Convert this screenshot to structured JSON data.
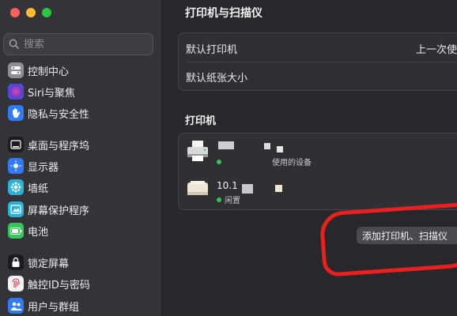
{
  "window": {
    "traffic_lights": {
      "close": "#ff5f57",
      "minimize": "#febc2e",
      "zoom": "#28c840"
    }
  },
  "sidebar": {
    "search_placeholder": "搜索",
    "items": [
      {
        "label": "控制中心",
        "icon": "control-center-icon",
        "color": "#8e8e93"
      },
      {
        "label": "Siri与聚焦",
        "icon": "siri-icon",
        "color": "#5b3fd1"
      },
      {
        "label": "隐私与安全性",
        "icon": "hand-icon",
        "color": "#2f7cf6"
      },
      {
        "label": "桌面与程序坞",
        "icon": "dock-icon",
        "color": "#1c1c1e"
      },
      {
        "label": "显示器",
        "icon": "display-icon",
        "color": "#2f7cf6"
      },
      {
        "label": "墙纸",
        "icon": "wallpaper-icon",
        "color": "#2bb3d6"
      },
      {
        "label": "屏幕保护程序",
        "icon": "screensaver-icon",
        "color": "#2bb3d6"
      },
      {
        "label": "电池",
        "icon": "battery-icon",
        "color": "#35c759"
      },
      {
        "label": "锁定屏幕",
        "icon": "lock-icon",
        "color": "#1c1c1e"
      },
      {
        "label": "触控ID与密码",
        "icon": "fingerprint-icon",
        "color": "#f2f2f4"
      },
      {
        "label": "用户与群组",
        "icon": "users-icon",
        "color": "#2f7cf6"
      }
    ]
  },
  "main": {
    "title": "打印机与扫描仪",
    "settings": {
      "default_printer_label": "默认打印机",
      "default_printer_value": "上一次使",
      "default_paper_label": "默认纸张大小"
    },
    "printers_section_title": "打印机",
    "printers": [
      {
        "name": "",
        "status": "使用的设备",
        "icon": "printer-icon"
      },
      {
        "name": "10.1",
        "status": "闲置",
        "icon": "printer-icon"
      }
    ],
    "add_button_label": "添加打印机、扫描仪"
  }
}
